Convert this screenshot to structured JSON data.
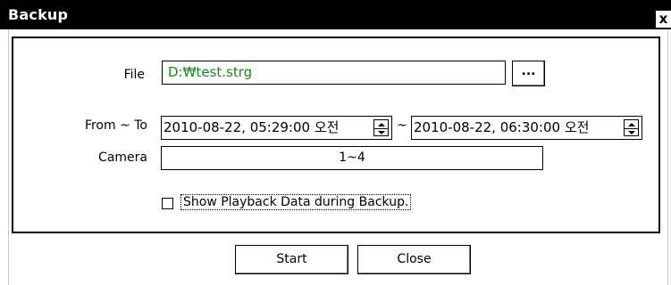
{
  "window": {
    "title": "Backup",
    "close_glyph": "x"
  },
  "file": {
    "label": "File",
    "value": "D:₩test.strg",
    "browse_label": "...",
    "value_color": "#1a8a1a"
  },
  "range": {
    "label": "From ~ To",
    "from_value": "2010-08-22, 05:29:00 오전",
    "separator": "~",
    "to_value": "2010-08-22, 06:30:00 오전"
  },
  "camera": {
    "label": "Camera",
    "value": "1~4"
  },
  "option": {
    "label": "Show Playback Data during Backup.",
    "checked": false
  },
  "buttons": {
    "start": "Start",
    "close": "Close"
  }
}
